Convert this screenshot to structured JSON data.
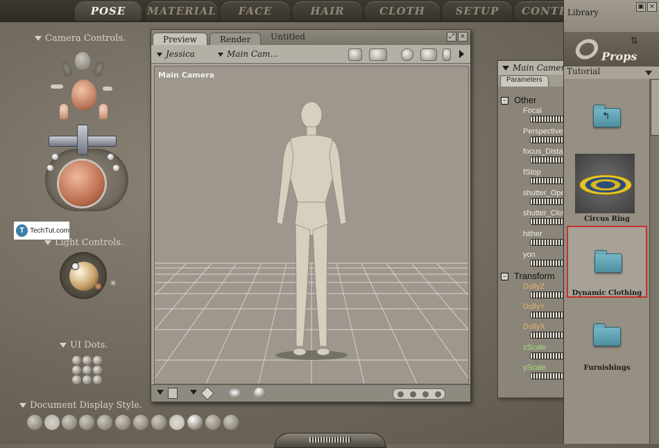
{
  "tabs": [
    {
      "label": "POSE",
      "active": true
    },
    {
      "label": "MATERIAL",
      "active": false
    },
    {
      "label": "FACE",
      "active": false
    },
    {
      "label": "HAIR",
      "active": false
    },
    {
      "label": "CLOTH",
      "active": false
    },
    {
      "label": "SETUP",
      "active": false
    },
    {
      "label": "CONTE",
      "active": false
    }
  ],
  "left_panel": {
    "camera_controls": "Camera Controls.",
    "light_controls": "Light Controls.",
    "ui_dots": "UI Dots.",
    "document_display_style": "Document Display Style."
  },
  "watermark": {
    "letter": "T",
    "text": "TechTut.com"
  },
  "preview_window": {
    "tabs": [
      "Preview",
      "Render"
    ],
    "title": "Untitled",
    "figure_dropdown": "Jessica",
    "camera_dropdown": "Main Cam...",
    "viewport_label": "Main Camera"
  },
  "params_panel": {
    "title": "Main Camera",
    "tab": "Parameters",
    "groups": [
      {
        "name": "Other",
        "params": [
          {
            "label": "Focal",
            "color": "white"
          },
          {
            "label": "Perspective",
            "color": "white"
          },
          {
            "label": "focus_Distan",
            "color": "white"
          },
          {
            "label": "fStop",
            "color": "white"
          },
          {
            "label": "shutter_Ope",
            "color": "white"
          },
          {
            "label": "shutter_Clos",
            "color": "white"
          },
          {
            "label": "hither",
            "color": "white"
          },
          {
            "label": "yon",
            "color": "white"
          }
        ]
      },
      {
        "name": "Transform",
        "params": [
          {
            "label": "DollyZ",
            "color": "orange"
          },
          {
            "label": "DollyY",
            "color": "orange"
          },
          {
            "label": "DollyX",
            "color": "orange"
          },
          {
            "label": "zScale",
            "color": "green"
          },
          {
            "label": "yScale",
            "color": "green"
          }
        ]
      }
    ]
  },
  "library": {
    "title": "Library",
    "category": "Props",
    "subcategory": "Tutorial",
    "items": [
      {
        "label": "",
        "kind": "folder-up"
      },
      {
        "label": "Circus Ring",
        "kind": "thumbnail"
      },
      {
        "label": "Dynamic Clothing",
        "kind": "folder",
        "selected": true
      },
      {
        "label": "Furnishings",
        "kind": "folder"
      }
    ]
  },
  "colors": {
    "background": "#6e675c",
    "selection_border": "#c8302c",
    "folder": "#5fa0b2"
  }
}
